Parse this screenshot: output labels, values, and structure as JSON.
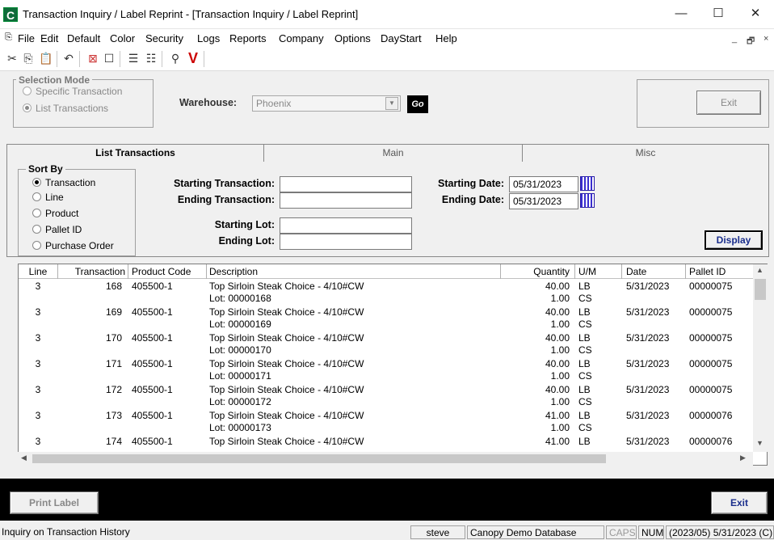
{
  "window": {
    "title": "Transaction Inquiry / Label Reprint - [Transaction Inquiry / Label Reprint]",
    "minimize": "—",
    "maximize": "☐",
    "close": "✕"
  },
  "menu": [
    "File",
    "Edit",
    "Default",
    "Color",
    "Security",
    "Logs",
    "Reports",
    "Company",
    "Options",
    "DayStart",
    "Help"
  ],
  "selection_mode": {
    "label": "Selection Mode",
    "options": [
      "Specific Transaction",
      "List Transactions"
    ],
    "selected": "List Transactions",
    "warehouse_label": "Warehouse:",
    "warehouse_value": "Phoenix",
    "go_label": "Go",
    "exit_label": "Exit"
  },
  "tabs": [
    "List Transactions",
    "Main",
    "Misc"
  ],
  "active_tab": "List Transactions",
  "sort_by": {
    "label": "Sort By",
    "options": [
      "Transaction",
      "Line",
      "Product",
      "Pallet ID",
      "Purchase Order"
    ],
    "selected": "Transaction"
  },
  "filters": {
    "starting_transaction_label": "Starting Transaction:",
    "ending_transaction_label": "Ending Transaction:",
    "starting_lot_label": "Starting Lot:",
    "ending_lot_label": "Ending Lot:",
    "starting_date_label": "Starting Date:",
    "ending_date_label": "Ending Date:",
    "starting_date": "05/31/2023",
    "ending_date": "05/31/2023",
    "display_label": "Display"
  },
  "grid": {
    "columns": [
      "Line",
      "Transaction",
      "Product Code",
      "Description",
      "Quantity",
      "U/M",
      "Date",
      "Pallet ID"
    ],
    "rows": [
      {
        "line": "3",
        "transaction": "168",
        "product": "405500-1",
        "description": "Top Sirloin Steak Choice - 4/10#CW",
        "lot": "Lot: 00000168",
        "qty": "40.00",
        "um": "LB",
        "qty2": "1.00",
        "um2": "CS",
        "date": "5/31/2023",
        "pallet": "00000075"
      },
      {
        "line": "3",
        "transaction": "169",
        "product": "405500-1",
        "description": "Top Sirloin Steak Choice - 4/10#CW",
        "lot": "Lot: 00000169",
        "qty": "40.00",
        "um": "LB",
        "qty2": "1.00",
        "um2": "CS",
        "date": "5/31/2023",
        "pallet": "00000075"
      },
      {
        "line": "3",
        "transaction": "170",
        "product": "405500-1",
        "description": "Top Sirloin Steak Choice - 4/10#CW",
        "lot": "Lot: 00000170",
        "qty": "40.00",
        "um": "LB",
        "qty2": "1.00",
        "um2": "CS",
        "date": "5/31/2023",
        "pallet": "00000075"
      },
      {
        "line": "3",
        "transaction": "171",
        "product": "405500-1",
        "description": "Top Sirloin Steak Choice - 4/10#CW",
        "lot": "Lot: 00000171",
        "qty": "40.00",
        "um": "LB",
        "qty2": "1.00",
        "um2": "CS",
        "date": "5/31/2023",
        "pallet": "00000075"
      },
      {
        "line": "3",
        "transaction": "172",
        "product": "405500-1",
        "description": "Top Sirloin Steak Choice - 4/10#CW",
        "lot": "Lot: 00000172",
        "qty": "40.00",
        "um": "LB",
        "qty2": "1.00",
        "um2": "CS",
        "date": "5/31/2023",
        "pallet": "00000075"
      },
      {
        "line": "3",
        "transaction": "173",
        "product": "405500-1",
        "description": "Top Sirloin Steak Choice - 4/10#CW",
        "lot": "Lot: 00000173",
        "qty": "41.00",
        "um": "LB",
        "qty2": "1.00",
        "um2": "CS",
        "date": "5/31/2023",
        "pallet": "00000076"
      },
      {
        "line": "3",
        "transaction": "174",
        "product": "405500-1",
        "description": "Top Sirloin Steak Choice - 4/10#CW",
        "lot": "",
        "qty": "41.00",
        "um": "LB",
        "qty2": "",
        "um2": "",
        "date": "5/31/2023",
        "pallet": "00000076"
      }
    ]
  },
  "bottom": {
    "print_label": "Print Label",
    "exit_label": "Exit"
  },
  "status": {
    "message": "Inquiry on Transaction History",
    "user": "steve",
    "database": "Canopy Demo Database",
    "caps": "CAPS",
    "num": "NUM",
    "period": "(2023/05) 5/31/2023 (C)"
  }
}
